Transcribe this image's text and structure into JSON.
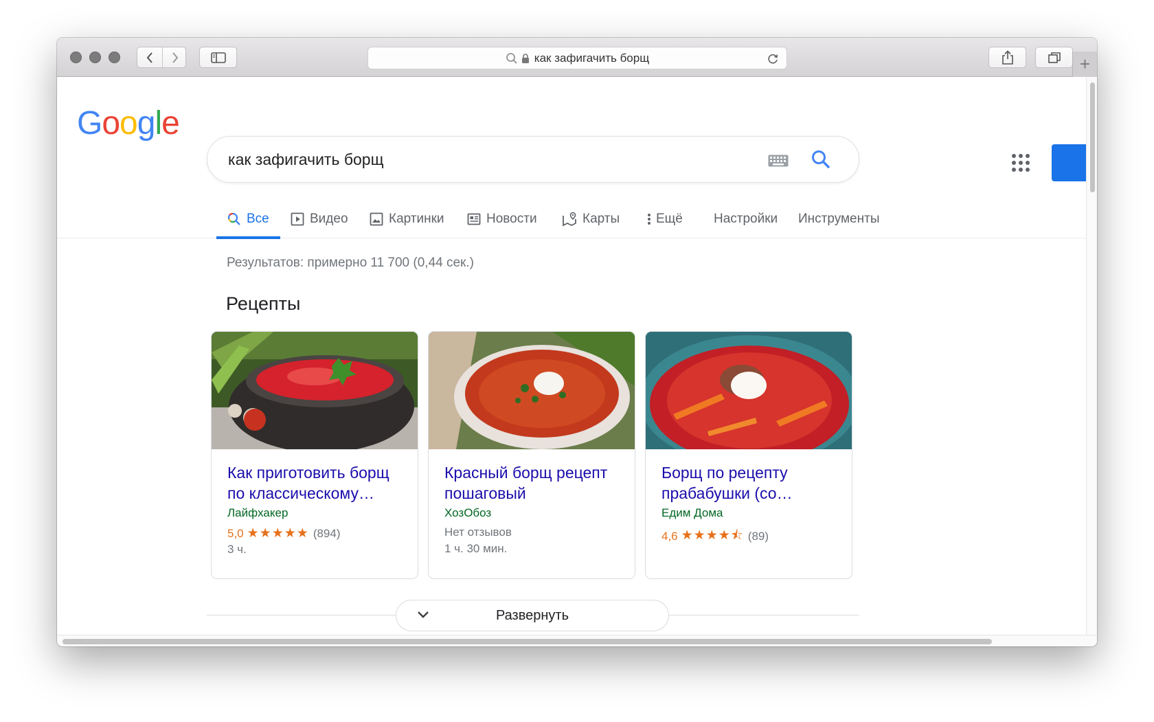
{
  "browser": {
    "address_text": "как зафигачить борщ",
    "new_tab_label": "+"
  },
  "google": {
    "logo_letters": [
      {
        "ch": "G",
        "color": "#4285F4"
      },
      {
        "ch": "o",
        "color": "#EA4335"
      },
      {
        "ch": "o",
        "color": "#FBBC05"
      },
      {
        "ch": "g",
        "color": "#4285F4"
      },
      {
        "ch": "l",
        "color": "#34A853"
      },
      {
        "ch": "e",
        "color": "#EA4335"
      }
    ],
    "query": "как зафигачить борщ",
    "accent": "#1a73e8"
  },
  "tabs": [
    {
      "label": "Все",
      "icon": "search-icon",
      "active": true
    },
    {
      "label": "Видео",
      "icon": "video-icon"
    },
    {
      "label": "Картинки",
      "icon": "image-icon"
    },
    {
      "label": "Новости",
      "icon": "news-icon"
    },
    {
      "label": "Карты",
      "icon": "map-icon"
    },
    {
      "label": "Ещё",
      "icon": "more-vert-icon"
    },
    {
      "label": "Настройки"
    },
    {
      "label": "Инструменты"
    }
  ],
  "results": {
    "stats": "Результатов: примерно 11 700 (0,44 сек.)",
    "section_title": "Рецепты"
  },
  "recipes": [
    {
      "title_line1": "Как приготовить борщ",
      "title_line2": "по классическому…",
      "source": "Лайфхакер",
      "rating": "5,0",
      "stars": "★★★★★",
      "reviews": "(894)",
      "time": "3 ч."
    },
    {
      "title_line1": "Красный борщ рецепт",
      "title_line2": "пошаговый",
      "source": "ХозОбоз",
      "no_reviews": "Нет отзывов",
      "time": "1 ч. 30 мин."
    },
    {
      "title_line1": "Борщ по рецепту",
      "title_line2": "прабабушки (со…",
      "source": "Едим Дома",
      "rating": "4,6",
      "stars": "★★★★⯪",
      "reviews": "(89)"
    }
  ],
  "expand_label": "Развернуть"
}
